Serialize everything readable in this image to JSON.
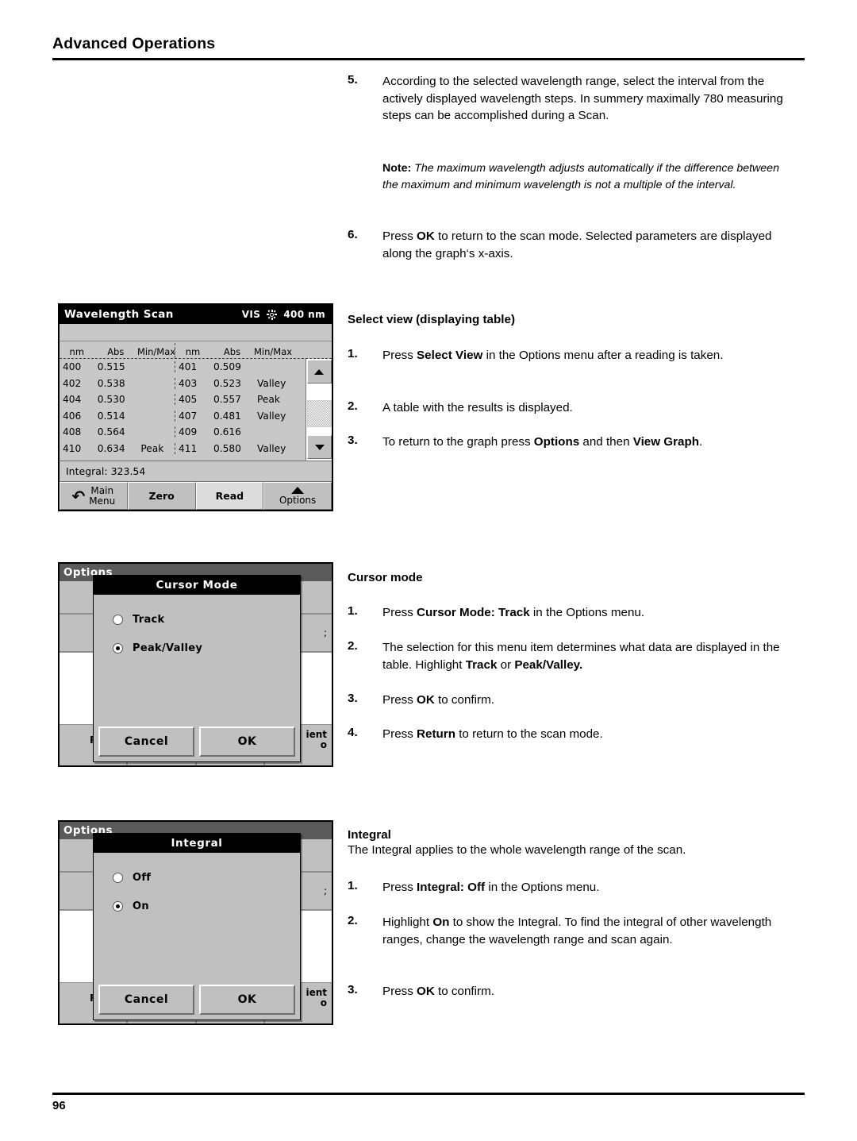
{
  "header": {
    "title": "Advanced Operations"
  },
  "footer": {
    "page_number": "96"
  },
  "steps": {
    "step5": {
      "num": "5.",
      "text": "According to the selected wavelength range, select the interval from the actively displayed wavelength steps. In summery maximally 780 measuring steps can be accomplished during a Scan."
    },
    "note": {
      "label": "Note:",
      "text": " The maximum wavelength adjusts automatically if the difference between the maximum and minimum wavelength is not a multiple of the interval."
    },
    "step6": {
      "num": "6.",
      "t1": "Press ",
      "b1": "OK",
      "t2": " to return to the scan mode. Selected parameters are displayed along the graph‘s x-axis."
    }
  },
  "select_view": {
    "heading": "Select view (displaying table)",
    "items": [
      {
        "num": "1.",
        "t1": "Press ",
        "b1": "Select View",
        "t2": " in the Options menu after a reading is taken.",
        "b2": "",
        "t3": ""
      },
      {
        "num": "2.",
        "t1": "A table with the results is displayed.",
        "b1": "",
        "t2": "",
        "b2": "",
        "t3": ""
      },
      {
        "num": "3.",
        "t1": "To return to the graph press ",
        "b1": "Options",
        "t2": " and then ",
        "b2": "View Graph",
        "t3": "."
      }
    ]
  },
  "cursor_mode_text": {
    "heading": "Cursor mode",
    "items": [
      {
        "num": "1.",
        "t1": "Press ",
        "b1": "Cursor Mode: Track",
        "t2": " in the Options menu.",
        "b2": "",
        "t3": ""
      },
      {
        "num": "2.",
        "t1": "The selection for this menu item determines what data are displayed in the table. Highlight ",
        "b1": "Track",
        "t2": " or ",
        "b2": "Peak/Valley.",
        "t3": ""
      },
      {
        "num": "3.",
        "t1": "Press ",
        "b1": "OK",
        "t2": " to confirm.",
        "b2": "",
        "t3": ""
      },
      {
        "num": "4.",
        "t1": "Press ",
        "b1": "Return",
        "t2": " to return to the scan mode.",
        "b2": "",
        "t3": ""
      }
    ]
  },
  "integral_text": {
    "heading": "Integral",
    "intro": "The Integral applies to the whole wavelength range of the scan.",
    "items": [
      {
        "num": "1.",
        "t1": "Press ",
        "b1": "Integral: Off",
        "t2": " in the Options menu.",
        "b2": "",
        "t3": ""
      },
      {
        "num": "2.",
        "t1": "Highlight ",
        "b1": "On",
        "t2": " to show the Integral. To find the integral of other wavelength ranges, change the wavelength range and scan again.",
        "b2": "",
        "t3": ""
      },
      {
        "num": "3.",
        "t1": "Press ",
        "b1": "OK",
        "t2": " to confirm.",
        "b2": "",
        "t3": ""
      }
    ]
  },
  "screens": {
    "scan_table": {
      "title": "Wavelength Scan",
      "mode": "VIS",
      "lamp_icon": "sun-icon",
      "wavelength": "400 nm",
      "columns": [
        "nm",
        "Abs",
        "Min/Max"
      ],
      "rows_left": [
        [
          "400",
          "0.515",
          ""
        ],
        [
          "402",
          "0.538",
          ""
        ],
        [
          "404",
          "0.530",
          ""
        ],
        [
          "406",
          "0.514",
          ""
        ],
        [
          "408",
          "0.564",
          ""
        ],
        [
          "410",
          "0.634",
          "Peak"
        ]
      ],
      "rows_right": [
        [
          "401",
          "0.509",
          ""
        ],
        [
          "403",
          "0.523",
          "Valley"
        ],
        [
          "405",
          "0.557",
          "Peak"
        ],
        [
          "407",
          "0.481",
          "Valley"
        ],
        [
          "409",
          "0.616",
          ""
        ],
        [
          "411",
          "0.580",
          "Valley"
        ]
      ],
      "integral_label": "Integral: 323.54",
      "buttons": {
        "main_menu_l1": "Main",
        "main_menu_l2": "Menu",
        "zero": "Zero",
        "read": "Read",
        "options": "Options"
      },
      "scrollbar": {
        "up_icon": "triangle-up-icon",
        "down_icon": "triangle-down-icon"
      }
    },
    "cursor_mode_dialog": {
      "background_title": "Options",
      "background_footer_left": "R",
      "background_footer_right_l1": "ient",
      "background_footer_right_l2": "o",
      "background_row_right": ";",
      "dialog_title": "Cursor Mode",
      "options": [
        {
          "label": "Track",
          "selected": false
        },
        {
          "label": "Peak/Valley",
          "selected": true
        }
      ],
      "cancel": "Cancel",
      "ok": "OK"
    },
    "integral_dialog": {
      "background_title": "Options",
      "background_footer_left": "R",
      "background_footer_right_l1": "ient",
      "background_footer_right_l2": "o",
      "background_row_right": ";",
      "dialog_title": "Integral",
      "options": [
        {
          "label": "Off",
          "selected": false
        },
        {
          "label": "On",
          "selected": true
        }
      ],
      "cancel": "Cancel",
      "ok": "OK"
    }
  }
}
